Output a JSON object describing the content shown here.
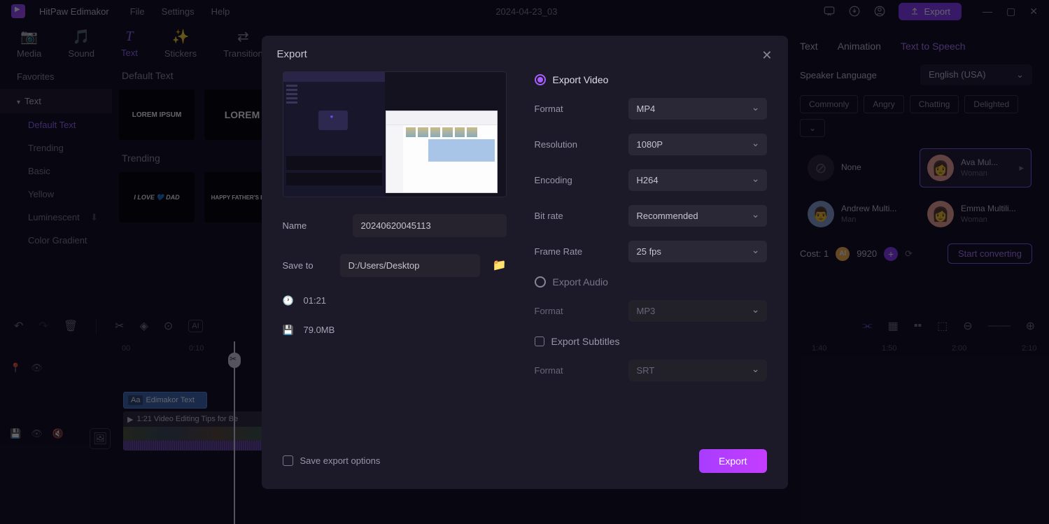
{
  "titlebar": {
    "app": "HitPaw Edimakor",
    "menus": [
      "File",
      "Settings",
      "Help"
    ],
    "project": "2024-04-23_03",
    "export_label": "Export"
  },
  "tabs": {
    "items": [
      "Media",
      "Sound",
      "Text",
      "Stickers",
      "Transition"
    ],
    "active": "Text"
  },
  "sidebar": {
    "favorites": "Favorites",
    "text_header": "Text",
    "subs": [
      "Default Text",
      "Trending",
      "Basic",
      "Yellow",
      "Luminescent",
      "Color Gradient"
    ],
    "active": "Default Text"
  },
  "templates": {
    "section1": "Default Text",
    "section2": "Trending",
    "t1": "LOREM IPSUM",
    "t2": "LOREM",
    "t3": "I LOVE 💙 DAD",
    "t4": "HAPPY FATHER'S DAY"
  },
  "props": {
    "tabs": [
      "Text",
      "Animation",
      "Text to Speech"
    ],
    "active": "Text to Speech",
    "lang_label": "Speaker Language",
    "lang_value": "English (USA)",
    "chips": [
      "Commonly",
      "Angry",
      "Chatting",
      "Delighted"
    ],
    "voices": [
      {
        "name": "None",
        "sub": ""
      },
      {
        "name": "Ava Mul...",
        "sub": "Woman"
      },
      {
        "name": "Andrew Multi...",
        "sub": "Man"
      },
      {
        "name": "Emma Multili...",
        "sub": "Woman"
      }
    ],
    "cost_label": "Cost: 1",
    "coins": "9920",
    "convert": "Start converting"
  },
  "timeline": {
    "marks": [
      "00",
      "0:10",
      "1:40",
      "1:50",
      "2:00",
      "2:10"
    ],
    "text_clip": "Edimakor Text",
    "text_badge": "Aa",
    "video_clip": "1:21 Video Editing Tips for Be"
  },
  "modal": {
    "title": "Export",
    "name_label": "Name",
    "name_value": "20240620045113",
    "save_label": "Save to",
    "save_value": "D:/Users/Desktop",
    "duration": "01:21",
    "size": "79.0MB",
    "video_hdr": "Export Video",
    "audio_hdr": "Export Audio",
    "sub_hdr": "Export Subtitles",
    "fields": {
      "format_l": "Format",
      "format_v": "MP4",
      "res_l": "Resolution",
      "res_v": "1080P",
      "enc_l": "Encoding",
      "enc_v": "H264",
      "bit_l": "Bit rate",
      "bit_v": "Recommended",
      "fps_l": "Frame Rate",
      "fps_v": "25  fps",
      "afmt_l": "Format",
      "afmt_v": "MP3",
      "sfmt_l": "Format",
      "sfmt_v": "SRT"
    },
    "save_opts": "Save export options",
    "export_btn": "Export"
  }
}
